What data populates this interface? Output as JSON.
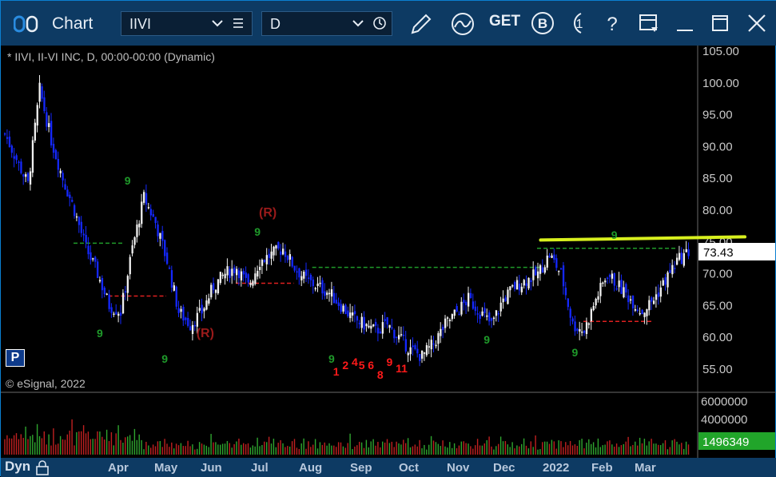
{
  "titlebar": {
    "app_title": "Chart",
    "symbol": "IIVI",
    "interval": "D",
    "get_label": "GET"
  },
  "header_text": "* IIVI, II-VI INC, D, 00:00-00:00 (Dynamic)",
  "copyright": "© eSignal, 2022",
  "p_label": "P",
  "dyn_label": "Dyn",
  "price_marker": "73.43",
  "volume_marker": "1496349",
  "colors": {
    "up": "#f0f0f0",
    "down": "#1428ff",
    "titlebar": "#0d3a63",
    "trendline": "#d8f01e",
    "price_tag_bg": "#ffffff",
    "volume_tag_bg": "#21a52a"
  },
  "chart_data": {
    "type": "candlestick",
    "price_axis": {
      "ticks": [
        "105.00",
        "100.00",
        "95.00",
        "90.00",
        "85.00",
        "80.00",
        "75.00",
        "70.00",
        "65.00",
        "60.00",
        "55.00"
      ],
      "ylim": [
        51,
        106
      ]
    },
    "volume_axis": {
      "ticks": [
        "6000000",
        "4000000"
      ],
      "ylim": [
        0,
        6500000
      ]
    },
    "x_labels": [
      "Apr",
      "May",
      "Jun",
      "Jul",
      "Aug",
      "Sep",
      "Oct",
      "Nov",
      "Dec",
      "2022",
      "Feb",
      "Mar"
    ],
    "close_path": [
      [
        0,
        92
      ],
      [
        5,
        88
      ],
      [
        10,
        84
      ],
      [
        15,
        99
      ],
      [
        20,
        91
      ],
      [
        25,
        85
      ],
      [
        30,
        80
      ],
      [
        35,
        74
      ],
      [
        40,
        70
      ],
      [
        45,
        65
      ],
      [
        50,
        64
      ],
      [
        55,
        74
      ],
      [
        60,
        82
      ],
      [
        65,
        78
      ],
      [
        70,
        72
      ],
      [
        75,
        64
      ],
      [
        80,
        62
      ],
      [
        85,
        64
      ],
      [
        90,
        68
      ],
      [
        95,
        70
      ],
      [
        100,
        71
      ],
      [
        105,
        68
      ],
      [
        110,
        72
      ],
      [
        115,
        73
      ],
      [
        120,
        74
      ],
      [
        125,
        71
      ],
      [
        130,
        69
      ],
      [
        135,
        68
      ],
      [
        140,
        67
      ],
      [
        145,
        65
      ],
      [
        150,
        63
      ],
      [
        155,
        62
      ],
      [
        160,
        61
      ],
      [
        165,
        62
      ],
      [
        170,
        60
      ],
      [
        175,
        58
      ],
      [
        180,
        57
      ],
      [
        185,
        59
      ],
      [
        190,
        62
      ],
      [
        195,
        64
      ],
      [
        200,
        66
      ],
      [
        205,
        64
      ],
      [
        210,
        62
      ],
      [
        215,
        66
      ],
      [
        220,
        68
      ],
      [
        225,
        69
      ],
      [
        230,
        70
      ],
      [
        235,
        73
      ],
      [
        240,
        70
      ],
      [
        245,
        62
      ],
      [
        250,
        61
      ],
      [
        255,
        66
      ],
      [
        260,
        70
      ],
      [
        265,
        68
      ],
      [
        270,
        66
      ],
      [
        275,
        64
      ],
      [
        280,
        66
      ],
      [
        285,
        69
      ],
      [
        290,
        72
      ],
      [
        295,
        73.43
      ]
    ],
    "volume_pattern": [
      2,
      3,
      2,
      2,
      4,
      3,
      2,
      2,
      3,
      5,
      2,
      2,
      3,
      2,
      4,
      2,
      3,
      2,
      2,
      3
    ],
    "trendline": {
      "from": [
        235,
        75.3
      ],
      "to": [
        300,
        75.8
      ]
    },
    "td_labels": [
      {
        "text": "9",
        "bar": 52,
        "price": 84,
        "color": "green"
      },
      {
        "text": "9",
        "bar": 40,
        "price": 60,
        "color": "green"
      },
      {
        "text": "9",
        "bar": 68,
        "price": 56,
        "color": "green"
      },
      {
        "text": "9",
        "bar": 108,
        "price": 76,
        "color": "green"
      },
      {
        "text": "9",
        "bar": 140,
        "price": 56,
        "color": "green"
      },
      {
        "text": "9",
        "bar": 207,
        "price": 59,
        "color": "green"
      },
      {
        "text": "9",
        "bar": 262,
        "price": 75.5,
        "color": "green"
      },
      {
        "text": "9",
        "bar": 245,
        "price": 57,
        "color": "green"
      },
      {
        "text": "(R)",
        "bar": 110,
        "price": 79,
        "color": "red"
      },
      {
        "text": "(R)",
        "bar": 83,
        "price": 60,
        "color": "red"
      },
      {
        "text": "1",
        "bar": 142,
        "price": 54,
        "color": "red"
      },
      {
        "text": "2",
        "bar": 146,
        "price": 55,
        "color": "red"
      },
      {
        "text": "4",
        "bar": 150,
        "price": 55.5,
        "color": "red"
      },
      {
        "text": "5",
        "bar": 153,
        "price": 55,
        "color": "red"
      },
      {
        "text": "6",
        "bar": 157,
        "price": 55,
        "color": "red"
      },
      {
        "text": "8",
        "bar": 161,
        "price": 53.5,
        "color": "red"
      },
      {
        "text": "9",
        "bar": 165,
        "price": 55.5,
        "color": "red"
      },
      {
        "text": "11",
        "bar": 169,
        "price": 54.5,
        "color": "red"
      }
    ],
    "levels": [
      {
        "color": "green",
        "price": 74.8,
        "from": 30,
        "to": 52
      },
      {
        "color": "red",
        "price": 66.5,
        "from": 45,
        "to": 70
      },
      {
        "color": "red",
        "price": 68.5,
        "from": 100,
        "to": 125
      },
      {
        "color": "green",
        "price": 71,
        "from": 133,
        "to": 232
      },
      {
        "color": "green",
        "price": 74,
        "from": 230,
        "to": 290
      },
      {
        "color": "red",
        "price": 62.5,
        "from": 250,
        "to": 280
      }
    ]
  }
}
